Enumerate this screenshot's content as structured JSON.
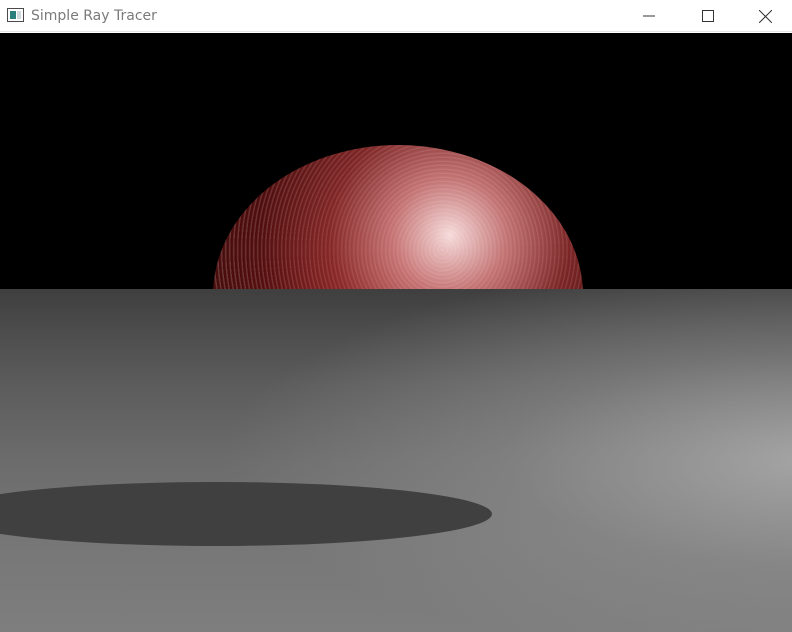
{
  "window": {
    "title": "Simple Ray Tracer",
    "app_icon": "window-app-icon",
    "controls": {
      "minimize_icon": "minimize-icon",
      "maximize_icon": "maximize-icon",
      "close_icon": "close-icon"
    }
  },
  "scene": {
    "background_color": "#000000",
    "sphere_color": "#6a1010",
    "floor_color": "#6c6c6c",
    "shadow_color": "#404040"
  }
}
